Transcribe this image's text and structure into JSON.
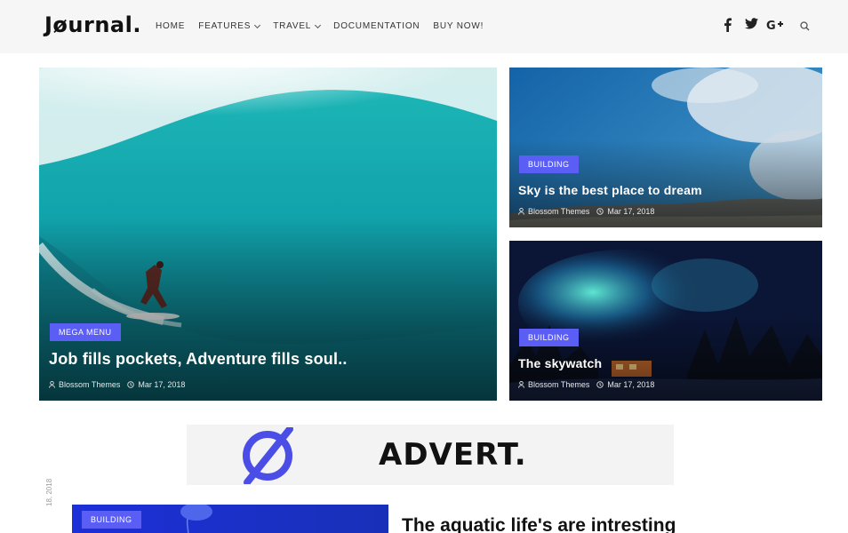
{
  "header": {
    "logo": "Jøurnal.",
    "nav": [
      {
        "label": "HOME",
        "dropdown": false
      },
      {
        "label": "FEATURES",
        "dropdown": true
      },
      {
        "label": "TRAVEL",
        "dropdown": true
      },
      {
        "label": "DOCUMENTATION",
        "dropdown": false
      },
      {
        "label": "BUY NOW!",
        "dropdown": false
      }
    ],
    "social_icons": [
      "facebook-icon",
      "twitter-icon",
      "google-plus-icon",
      "search-icon"
    ]
  },
  "featured": {
    "badge": "MEGA MENU",
    "title": "Job fills pockets, Adventure fills soul..",
    "author": "Blossom Themes",
    "date": "Mar 17, 2018"
  },
  "side_posts": [
    {
      "badge": "BUILDING",
      "title": "Sky is the best place to dream",
      "author": "Blossom Themes",
      "date": "Mar 17, 2018"
    },
    {
      "badge": "BUILDING",
      "title": "The skywatch",
      "author": "Blossom Themes",
      "date": "Mar 17, 2018"
    }
  ],
  "advert": {
    "text": "ADVERT."
  },
  "latest": {
    "date": "18, 2018",
    "badge": "BUILDING",
    "title": "The aquatic life's are intresting"
  },
  "colors": {
    "accent": "#5b5ef4",
    "header_bg": "#f6f6f6"
  }
}
